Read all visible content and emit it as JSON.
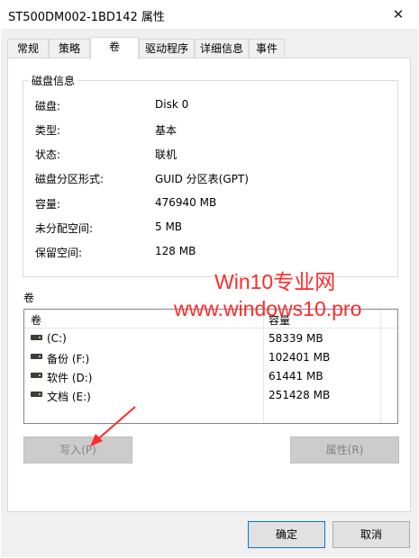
{
  "window": {
    "title": "ST500DM002-1BD142 属性",
    "close_glyph": "✕"
  },
  "tabs": [
    {
      "label": "常规"
    },
    {
      "label": "策略"
    },
    {
      "label": "卷"
    },
    {
      "label": "驱动程序"
    },
    {
      "label": "详细信息"
    },
    {
      "label": "事件"
    }
  ],
  "disk_info": {
    "group_label": "磁盘信息",
    "rows": [
      {
        "label": "磁盘:",
        "value": "Disk 0"
      },
      {
        "label": "类型:",
        "value": "基本"
      },
      {
        "label": "状态:",
        "value": "联机"
      },
      {
        "label": "磁盘分区形式:",
        "value": "GUID 分区表(GPT)"
      },
      {
        "label": "容量:",
        "value": "476940 MB"
      },
      {
        "label": "未分配空间:",
        "value": "5 MB"
      },
      {
        "label": "保留空间:",
        "value": "128 MB"
      }
    ]
  },
  "volumes": {
    "section_label": "卷",
    "col_volume": "卷",
    "col_capacity": "容量",
    "items": [
      {
        "name": "(C:)",
        "capacity": "58339 MB"
      },
      {
        "name": "备份 (F:)",
        "capacity": "102401 MB"
      },
      {
        "name": "软件 (D:)",
        "capacity": "61441 MB"
      },
      {
        "name": "文档 (E:)",
        "capacity": "251428 MB"
      }
    ]
  },
  "buttons": {
    "write": "写入(P)",
    "properties": "属性(R)",
    "ok": "确定",
    "cancel": "取消"
  },
  "watermark": {
    "line1": "Win10专业网",
    "line2": "www.windows10.pro"
  },
  "colors": {
    "watermark": "#ff2b2b",
    "accent": "#0078d7"
  }
}
